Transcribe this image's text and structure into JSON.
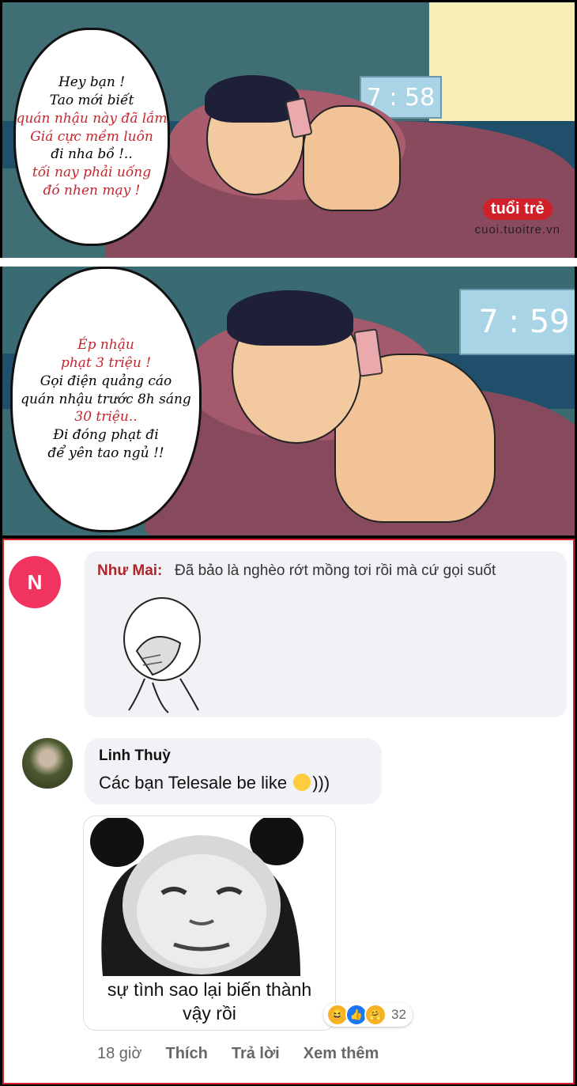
{
  "comic": {
    "panel1": {
      "clock": "7 : 58",
      "speech": [
        "Hey bạn !",
        "Tao mới biết",
        "quán nhậu này đã lắm",
        "Giá cực mềm luôn",
        "đi nha bồ !..",
        "tối nay phải uống",
        "đó nhen mạy !"
      ],
      "speech_colors": [
        "blk",
        "blk",
        "red",
        "red",
        "blk",
        "red",
        "red"
      ],
      "logo_badge": "tuổi trẻ",
      "logo_url": "cuoi.tuoitre.vn"
    },
    "panel2": {
      "clock": "7 : 59",
      "speech": [
        "Ép nhậu",
        "phạt 3 triệu !",
        "Gọi điện quảng cáo",
        "quán nhậu trước 8h sáng",
        "30 triệu..",
        "Đi đóng phạt đi",
        "để yên tao ngủ !!"
      ],
      "speech_colors": [
        "red",
        "red",
        "blk",
        "blk",
        "red",
        "blk",
        "blk"
      ]
    }
  },
  "comments": [
    {
      "avatar_letter": "N",
      "author": "Như Mai:",
      "text": "Đã bảo là nghèo rớt mồng tơi rồi mà cứ gọi suốt"
    },
    {
      "author": "Linh Thuỳ",
      "text_before": "Các bạn Telesale be like ",
      "text_after": ")))",
      "sticker_caption_line1": "sự tình sao lại biến thành",
      "sticker_caption_line2": "vậy rồi",
      "reaction_count": "32",
      "actions": {
        "time": "18 giờ",
        "like": "Thích",
        "reply": "Trả lời",
        "more": "Xem thêm"
      }
    }
  ]
}
